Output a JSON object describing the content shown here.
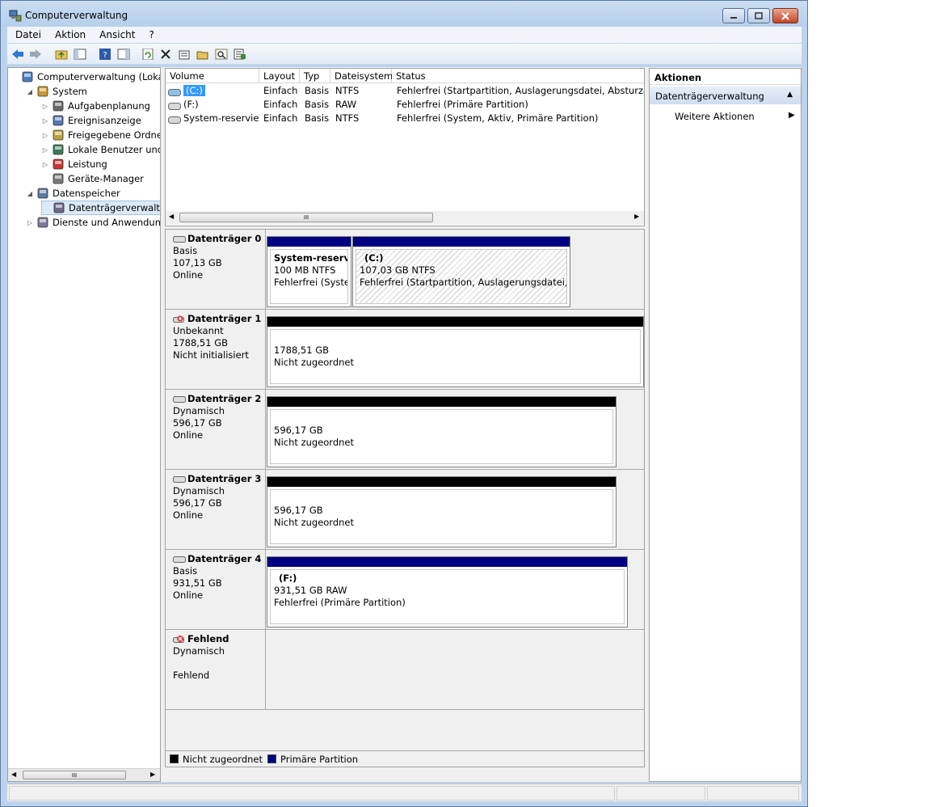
{
  "window": {
    "title": "Computerverwaltung"
  },
  "menu": [
    "Datei",
    "Aktion",
    "Ansicht",
    "?"
  ],
  "toolbar": [
    "back-icon",
    "forward-icon",
    "up-folder-icon",
    "show-hide-tree-icon",
    "help-icon",
    "show-hide-action-icon",
    "refresh-icon",
    "delete-icon",
    "properties-icon",
    "open-icon",
    "search-icon",
    "export-icon"
  ],
  "tree": {
    "items": [
      {
        "label": "Computerverwaltung (Lokal)",
        "icon": "computer-management-icon",
        "level": 0,
        "twisty": ""
      },
      {
        "label": "System",
        "icon": "system-tools-icon",
        "level": 1,
        "twisty": "◢"
      },
      {
        "label": "Aufgabenplanung",
        "icon": "task-scheduler-icon",
        "level": 2,
        "twisty": "▷"
      },
      {
        "label": "Ereignisanzeige",
        "icon": "event-viewer-icon",
        "level": 2,
        "twisty": "▷"
      },
      {
        "label": "Freigegebene Ordner",
        "icon": "shared-folders-icon",
        "level": 2,
        "twisty": "▷"
      },
      {
        "label": "Lokale Benutzer und Gruppen",
        "icon": "users-icon",
        "level": 2,
        "twisty": "▷"
      },
      {
        "label": "Leistung",
        "icon": "performance-icon",
        "level": 2,
        "twisty": "▷"
      },
      {
        "label": "Geräte-Manager",
        "icon": "device-manager-icon",
        "level": 2,
        "twisty": ""
      },
      {
        "label": "Datenspeicher",
        "icon": "storage-icon",
        "level": 1,
        "twisty": "◢"
      },
      {
        "label": "Datenträgerverwaltung",
        "icon": "disk-management-icon",
        "level": 2,
        "twisty": ""
      },
      {
        "label": "Dienste und Anwendungen",
        "icon": "services-icon",
        "level": 1,
        "twisty": "▷"
      }
    ],
    "selected_index": 9
  },
  "volumes": {
    "columns": [
      "Volume",
      "Layout",
      "Typ",
      "Dateisystem",
      "Status"
    ],
    "rows": [
      {
        "volume": "(C:)",
        "layout": "Einfach",
        "typ": "Basis",
        "fs": "NTFS",
        "status": "Fehlerfrei (Startpartition, Auslagerungsdatei, Absturzabbild"
      },
      {
        "volume": "(F:)",
        "layout": "Einfach",
        "typ": "Basis",
        "fs": "RAW",
        "status": "Fehlerfrei (Primäre Partition)"
      },
      {
        "volume": "System-reserviert",
        "layout": "Einfach",
        "typ": "Basis",
        "fs": "NTFS",
        "status": "Fehlerfrei (System, Aktiv, Primäre Partition)"
      }
    ],
    "scroll_glyph": "III"
  },
  "disks": [
    {
      "name": "Datenträger 0",
      "kind": "Basis",
      "size": "107,13 GB",
      "state": "Online",
      "partitions": [
        {
          "title": "System-reservie",
          "detail": "100 MB NTFS",
          "status": "Fehlerfrei (Systen"
        },
        {
          "title": "(C:)",
          "detail": "107,03 GB NTFS",
          "status": "Fehlerfrei (Startpartition, Auslagerungsdatei, Abs"
        }
      ]
    },
    {
      "name": "Datenträger 1",
      "kind": "Unbekannt",
      "size": "1788,51 GB",
      "state": "Nicht initialisiert",
      "partitions": [
        {
          "title": "",
          "detail": "1788,51 GB",
          "status": "Nicht zugeordnet"
        }
      ]
    },
    {
      "name": "Datenträger 2",
      "kind": "Dynamisch",
      "size": "596,17 GB",
      "state": "Online",
      "partitions": [
        {
          "title": "",
          "detail": "596,17 GB",
          "status": "Nicht zugeordnet"
        }
      ]
    },
    {
      "name": "Datenträger 3",
      "kind": "Dynamisch",
      "size": "596,17 GB",
      "state": "Online",
      "partitions": [
        {
          "title": "",
          "detail": "596,17 GB",
          "status": "Nicht zugeordnet"
        }
      ]
    },
    {
      "name": "Datenträger 4",
      "kind": "Basis",
      "size": "931,51 GB",
      "state": "Online",
      "partitions": [
        {
          "title": "(F:)",
          "detail": "931,51 GB RAW",
          "status": "Fehlerfrei (Primäre Partition)"
        }
      ]
    },
    {
      "name": "Fehlend",
      "kind": "Dynamisch",
      "size": "",
      "state": "Fehlend",
      "partitions": []
    }
  ],
  "legend": [
    {
      "label": "Nicht zugeordnet",
      "color": "#000000"
    },
    {
      "label": "Primäre Partition",
      "color": "#000080"
    }
  ],
  "actions": {
    "header": "Aktionen",
    "section": "Datenträgerverwaltung",
    "more": "Weitere Aktionen"
  },
  "colors": {
    "primary_partition": "#000080",
    "unallocated": "#000000"
  }
}
